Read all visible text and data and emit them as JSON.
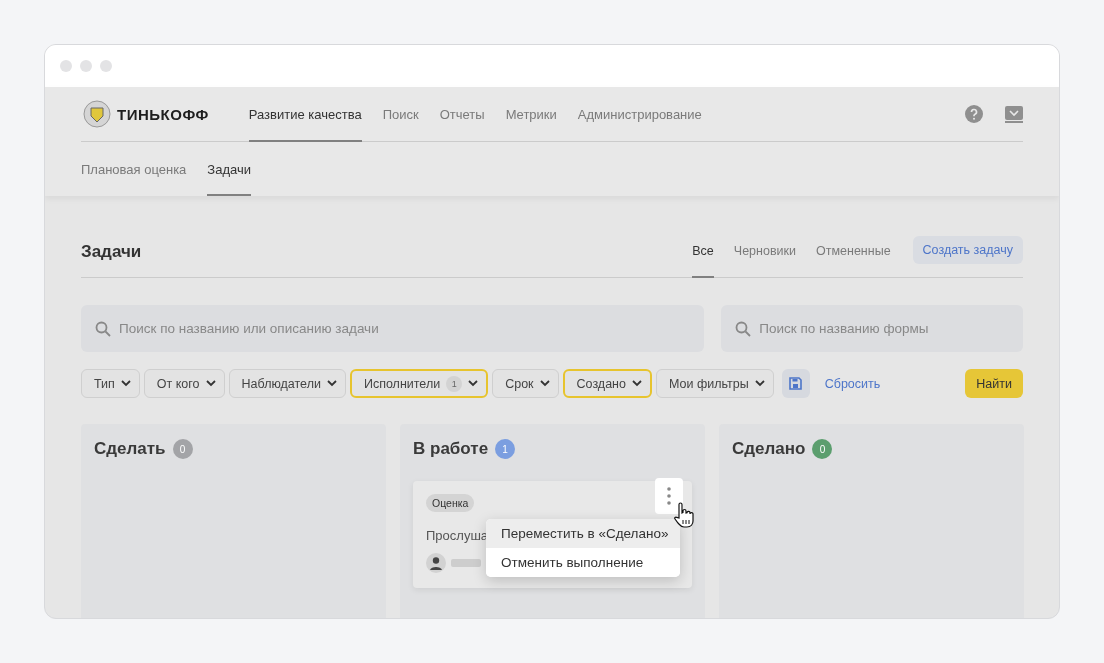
{
  "logo": {
    "text": "ТИНЬКОФФ"
  },
  "nav": [
    {
      "label": "Развитие качества",
      "selected": true
    },
    {
      "label": "Поиск",
      "selected": false
    },
    {
      "label": "Отчеты",
      "selected": false
    },
    {
      "label": "Метрики",
      "selected": false
    },
    {
      "label": "Администрирование",
      "selected": false
    }
  ],
  "subnav": [
    {
      "label": "Плановая оценка",
      "selected": false
    },
    {
      "label": "Задачи",
      "selected": true
    }
  ],
  "page_title": "Задачи",
  "view_tabs": [
    {
      "label": "Все",
      "selected": true
    },
    {
      "label": "Черновики",
      "selected": false
    },
    {
      "label": "Отмененные",
      "selected": false
    }
  ],
  "create_button": "Создать задачу",
  "search_task": {
    "placeholder": "Поиск по названию или описанию задачи"
  },
  "search_form": {
    "placeholder": "Поиск по названию формы"
  },
  "filters": [
    {
      "label": "Тип",
      "active": false
    },
    {
      "label": "От кого",
      "active": false
    },
    {
      "label": "Наблюдатели",
      "active": false
    },
    {
      "label": "Исполнители",
      "active": true,
      "count": "1"
    },
    {
      "label": "Срок",
      "active": false
    },
    {
      "label": "Создано",
      "active": true
    },
    {
      "label": "Мои фильтры",
      "active": false
    }
  ],
  "reset_link": "Сбросить",
  "find_button": "Найти",
  "columns": [
    {
      "title": "Сделать",
      "count": "0",
      "color": "#a3a4a7"
    },
    {
      "title": "В работе",
      "count": "1",
      "color": "#7b9ee0",
      "cards": [
        {
          "tag": "Оценка",
          "title": "Прослуша"
        }
      ]
    },
    {
      "title": "Сделано",
      "count": "0",
      "color": "#5b9e6e"
    }
  ],
  "context_menu": [
    {
      "label": "Переместить в «Сделано»",
      "selected": true
    },
    {
      "label": "Отменить выполнение",
      "selected": false
    }
  ]
}
